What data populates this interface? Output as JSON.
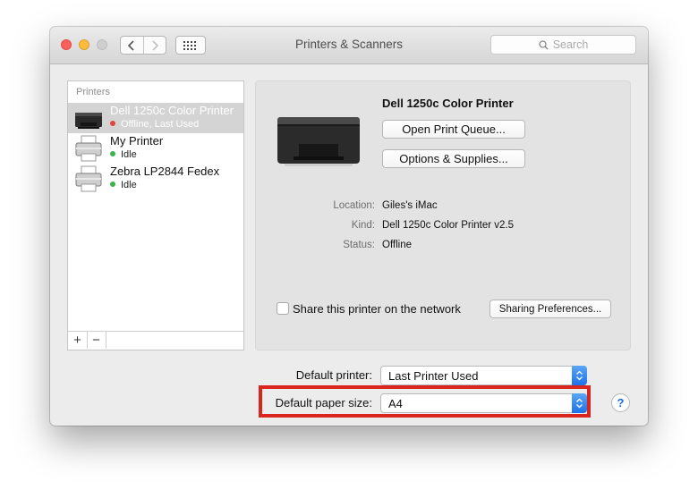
{
  "window": {
    "title": "Printers & Scanners",
    "search_placeholder": "Search"
  },
  "printer_list": {
    "header": "Printers",
    "items": [
      {
        "name": "Dell 1250c Color Printer",
        "status": "Offline, Last Used",
        "status_color": "#e0443e",
        "selected": true
      },
      {
        "name": "My Printer",
        "status": "Idle",
        "status_color": "#3bb54a",
        "selected": false
      },
      {
        "name": "Zebra LP2844 Fedex",
        "status": "Idle",
        "status_color": "#3bb54a",
        "selected": false
      }
    ],
    "add_label": "+",
    "remove_label": "−"
  },
  "detail": {
    "printer_name": "Dell 1250c Color Printer",
    "open_queue_label": "Open Print Queue...",
    "options_label": "Options & Supplies...",
    "location_label": "Location:",
    "location_value": "Giles's iMac",
    "kind_label": "Kind:",
    "kind_value": "Dell 1250c Color Printer v2.5",
    "status_label": "Status:",
    "status_value": "Offline",
    "share_label": "Share this printer on the network",
    "share_checked": false,
    "sharing_prefs_label": "Sharing Preferences..."
  },
  "defaults": {
    "default_printer_label": "Default printer:",
    "default_printer_value": "Last Printer Used",
    "paper_size_label": "Default paper size:",
    "paper_size_value": "A4"
  },
  "help_label": "?",
  "colors": {
    "accent": "#1e71e8",
    "highlight": "#d8251d",
    "selection": "#d4d4d4"
  }
}
